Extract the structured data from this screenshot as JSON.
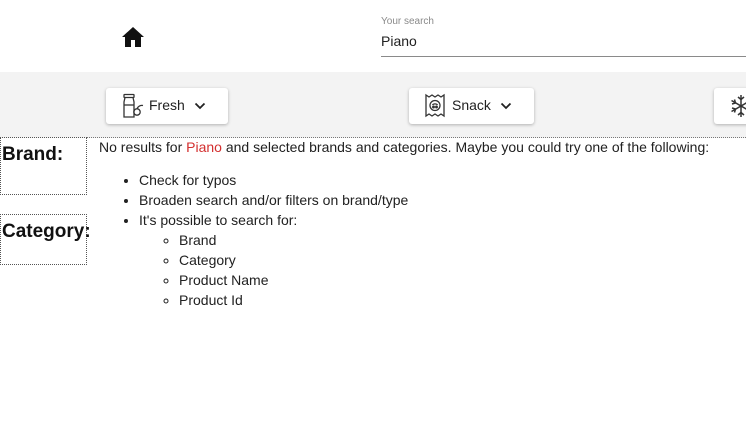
{
  "header": {
    "home_icon": "home-icon",
    "search": {
      "label": "Your search",
      "value": "Piano"
    }
  },
  "filters": [
    {
      "label": "Fresh",
      "icon": "milk-bottle-icon"
    },
    {
      "label": "Snack",
      "icon": "snack-bag-icon"
    },
    {
      "label": "",
      "icon": "snowflake-icon"
    }
  ],
  "facets": {
    "brand_title": "Brand:",
    "category_title": "Category:"
  },
  "results": {
    "prefix": "No results for ",
    "query": "Piano",
    "suffix": " and selected brands and categories. Maybe you could try one of the following:",
    "query_color": "#d32f2f",
    "suggestions": [
      "Check for typos",
      "Broaden search and/or filters on brand/type",
      "It's possible to search for:"
    ],
    "search_fields": [
      "Brand",
      "Category",
      "Product Name",
      "Product Id"
    ]
  }
}
